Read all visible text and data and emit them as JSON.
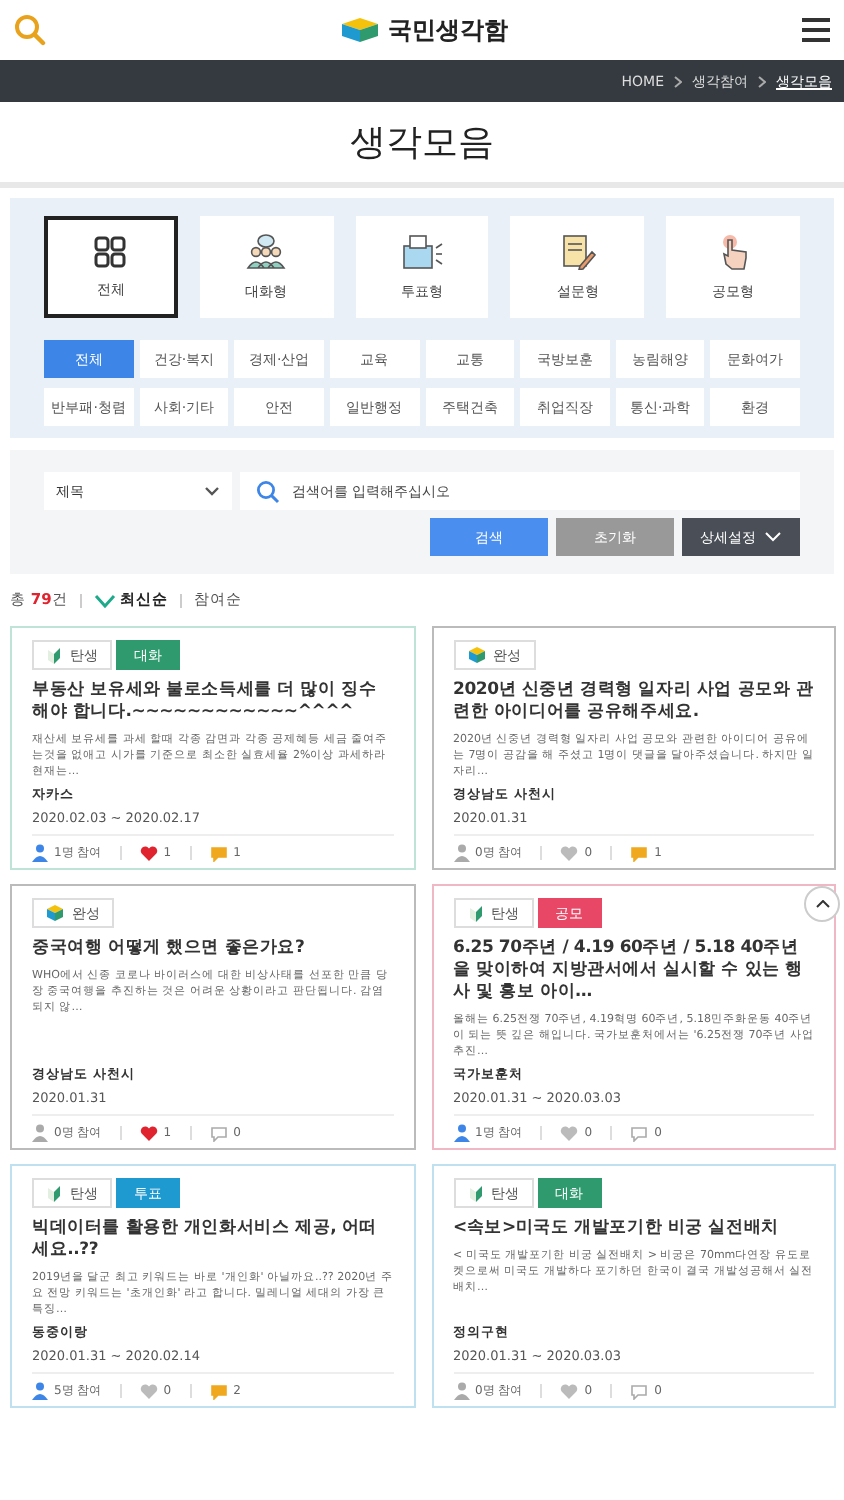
{
  "header": {
    "logo_text": "국민생각함"
  },
  "breadcrumb": [
    {
      "label": "HOME",
      "selected": false
    },
    {
      "label": "생각참여",
      "selected": false
    },
    {
      "label": "생각모음",
      "selected": true
    }
  ],
  "page_title": "생각모음",
  "type_filters": [
    {
      "label": "전체",
      "kind": "all",
      "selected": true
    },
    {
      "label": "대화형",
      "kind": "talk",
      "selected": false
    },
    {
      "label": "투표형",
      "kind": "vote",
      "selected": false
    },
    {
      "label": "설문형",
      "kind": "survey",
      "selected": false
    },
    {
      "label": "공모형",
      "kind": "contest",
      "selected": false
    }
  ],
  "categories": [
    {
      "label": "전체",
      "selected": true
    },
    {
      "label": "건강·복지",
      "selected": false
    },
    {
      "label": "경제·산업",
      "selected": false
    },
    {
      "label": "교육",
      "selected": false
    },
    {
      "label": "교통",
      "selected": false
    },
    {
      "label": "국방보훈",
      "selected": false
    },
    {
      "label": "농림해양",
      "selected": false
    },
    {
      "label": "문화여가",
      "selected": false
    },
    {
      "label": "반부패·청렴",
      "selected": false
    },
    {
      "label": "사회·기타",
      "selected": false
    },
    {
      "label": "안전",
      "selected": false
    },
    {
      "label": "일반행정",
      "selected": false
    },
    {
      "label": "주택건축",
      "selected": false
    },
    {
      "label": "취업직장",
      "selected": false
    },
    {
      "label": "통신·과학",
      "selected": false
    },
    {
      "label": "환경",
      "selected": false
    }
  ],
  "search": {
    "field_select": "제목",
    "placeholder": "검색어를 입력해주십시오",
    "buttons": [
      {
        "label": "검색",
        "kind": "primary"
      },
      {
        "label": "초기화",
        "kind": "reset"
      },
      {
        "label": "상세설정",
        "kind": "more"
      }
    ]
  },
  "summary": {
    "total_prefix": "총",
    "total_count": "79",
    "total_suffix": "건",
    "sorts": [
      {
        "label": "최신순",
        "selected": true
      },
      {
        "label": "참여순",
        "selected": false
      }
    ]
  },
  "cards": [
    {
      "color": "#bfe3d6",
      "stage": {
        "label": "탄생",
        "kind": "born"
      },
      "type": {
        "label": "대화",
        "kind": "talk"
      },
      "title": "부동산 보유세와 불로소득세를 더 많이 징수해야 합니다.~~~~~~~~~~~~^^^^",
      "summary": "재산세 보유세를 과세 할때 각종 감면과 각종 공제혜등 세금 줄여주는것을 없애고 시가를 기준으로 최소한 실효세율 2%이상 과세하라 현재는…",
      "author": "자카스",
      "period": "2020.02.03 ~ 2020.02.17",
      "participants": {
        "text": "1명 참여",
        "active": true
      },
      "likes": {
        "text": "1",
        "active": true
      },
      "comments": {
        "text": "1",
        "active": true
      }
    },
    {
      "color": "#bbbbbb",
      "stage": {
        "label": "완성",
        "kind": "done"
      },
      "title": "2020년 신중년 경력형 일자리 사업 공모와 관련한 아이디어를 공유해주세요.",
      "summary": "2020년 신중년 경력형 일자리 사업 공모와 관련한 아이디어 공유에는 7명이 공감을 해 주셨고 1명이 댓글을 달아주셨습니다. 하지만 일자리…",
      "author": "경상남도 사천시",
      "period": "2020.01.31",
      "participants": {
        "text": "0명 참여",
        "active": false
      },
      "likes": {
        "text": "0",
        "active": false
      },
      "comments": {
        "text": "1",
        "active": true
      }
    },
    {
      "color": "#bbbbbb",
      "stage": {
        "label": "완성",
        "kind": "done"
      },
      "title": "중국여행 어떻게 했으면 좋은가요?",
      "summary": "WHO에서 신종 코로나 바이러스에 대한 비상사태를 선포한 만큼 당장 중국여행을 추진하는 것은 어려운 상황이라고 판단됩니다. 감염되지 않…",
      "author": "경상남도 사천시",
      "period": "2020.01.31",
      "participants": {
        "text": "0명 참여",
        "active": false
      },
      "likes": {
        "text": "1",
        "active": true
      },
      "comments": {
        "text": "0",
        "active": false
      }
    },
    {
      "color": "#f0b8c4",
      "stage": {
        "label": "탄생",
        "kind": "born"
      },
      "type": {
        "label": "공모",
        "kind": "contest"
      },
      "title": "6.25 70주년 / 4.19 60주년 / 5.18 40주년을 맞이하여 지방관서에서 실시할 수 있는 행사 및 홍보 아이…",
      "summary": "올해는 6.25전쟁 70주년, 4.19혁명 60주년, 5.18민주화운동 40주년이 되는 뜻 깊은 해입니다. 국가보훈처에서는 '6.25전쟁 70주년 사업추진…",
      "author": "국가보훈처",
      "period": "2020.01.31 ~ 2020.03.03",
      "participants": {
        "text": "1명 참여",
        "active": true
      },
      "likes": {
        "text": "0",
        "active": false
      },
      "comments": {
        "text": "0",
        "active": false
      }
    },
    {
      "color": "#bfe0ef",
      "stage": {
        "label": "탄생",
        "kind": "born"
      },
      "type": {
        "label": "투표",
        "kind": "vote"
      },
      "title": "빅데이터를 활용한 개인화서비스 제공, 어떠세요..??",
      "summary": "2019년을 달군 최고 키워드는 바로 '개인화' 아닐까요..?? 2020년 주요 전망 키워드는 '초개인화' 라고 합니다. 밀레니얼 세대의 가장 큰 특징…",
      "author": "동중이랑",
      "period": "2020.01.31 ~ 2020.02.14",
      "participants": {
        "text": "5명 참여",
        "active": true
      },
      "likes": {
        "text": "0",
        "active": false
      },
      "comments": {
        "text": "2",
        "active": true
      }
    },
    {
      "color": "#bfe0ef",
      "stage": {
        "label": "탄생",
        "kind": "born"
      },
      "type": {
        "label": "대화",
        "kind": "talk"
      },
      "title": "<속보>미국도 개발포기한 비궁 실전배치",
      "summary": "< 미국도 개발포기한 비궁 실전배치 > 비궁은 70mm다연장 유도로켓으로써 미국도 개발하다 포기하던 한국이 결국 개발성공해서 실전배치…",
      "author": "정의구현",
      "period": "2020.01.31 ~ 2020.03.03",
      "participants": {
        "text": "0명 참여",
        "active": false
      },
      "likes": {
        "text": "0",
        "active": false
      },
      "comments": {
        "text": "0",
        "active": false
      }
    }
  ]
}
